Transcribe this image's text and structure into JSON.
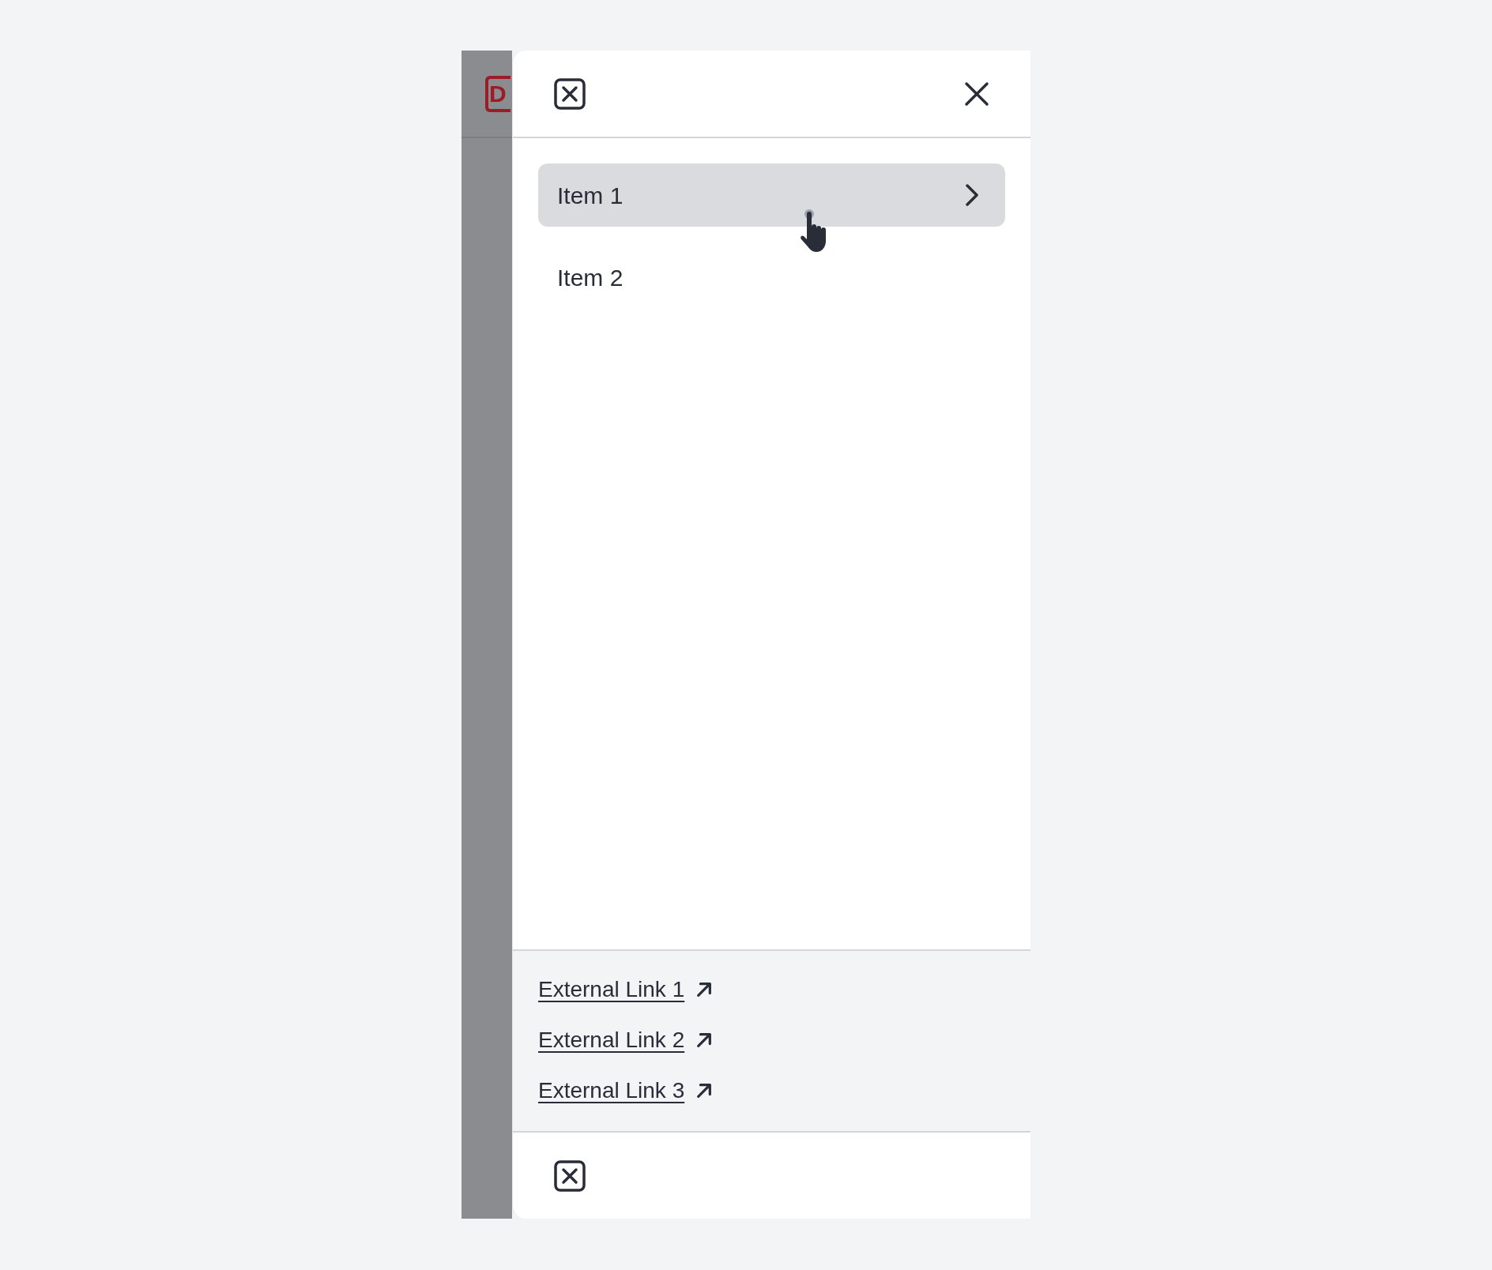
{
  "background_page": {
    "logo_text": "D"
  },
  "drawer": {
    "nav_items": [
      {
        "label": "Item 1",
        "highlighted": true,
        "expandable": true
      },
      {
        "label": "Item 2",
        "highlighted": false,
        "expandable": false
      }
    ],
    "external_links": [
      {
        "label": "External Link 1"
      },
      {
        "label": "External Link 2"
      },
      {
        "label": "External Link 3"
      }
    ]
  }
}
